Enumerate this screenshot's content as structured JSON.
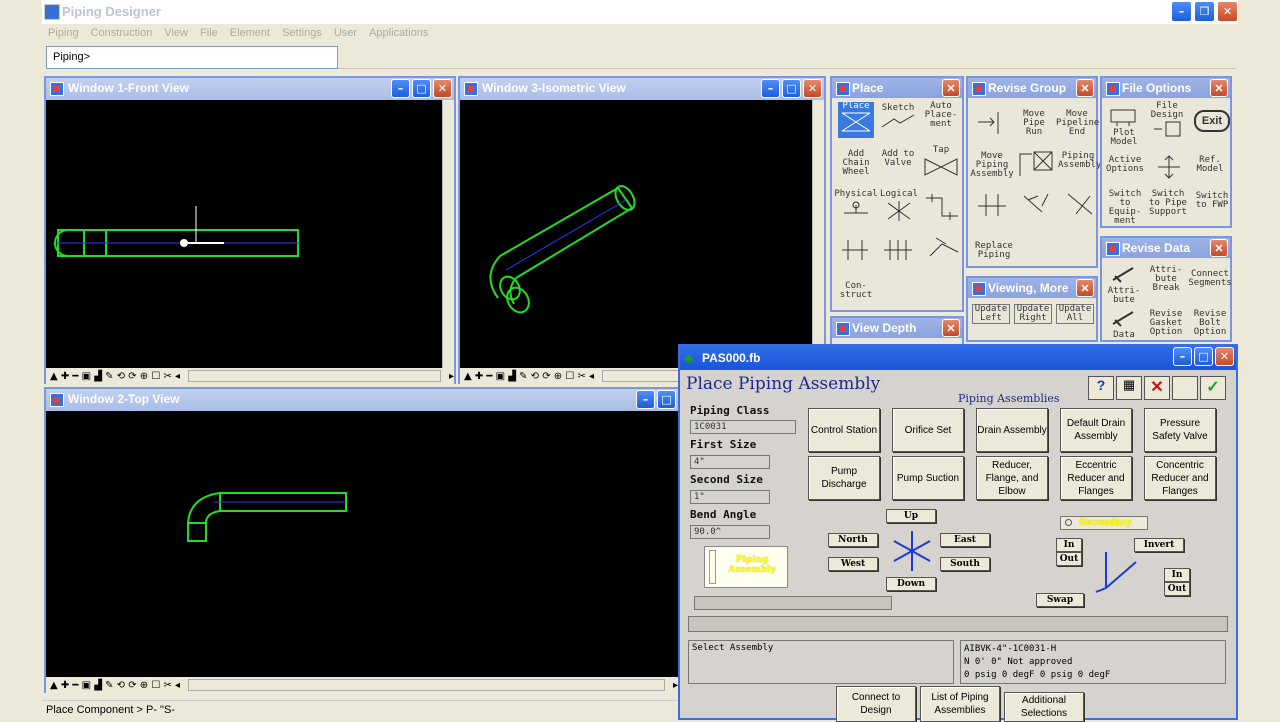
{
  "app": {
    "title": "Piping Designer",
    "menu": [
      "Piping",
      "Construction",
      "View",
      "File",
      "Element",
      "Settings",
      "User",
      "Applications"
    ],
    "command_prompt": "Piping>"
  },
  "views": {
    "front": {
      "title": "Window 1-Front View"
    },
    "iso": {
      "title": "Window 3-Isometric View"
    },
    "top": {
      "title": "Window 2-Top View"
    }
  },
  "palettes": {
    "place": {
      "title": "Place",
      "tools": [
        "Place",
        "Sketch",
        "Auto Place- ment",
        "Add Chain Wheel",
        "Add to Valve",
        "Tap",
        "Physical",
        "Logical",
        "Con- struct"
      ]
    },
    "revise_group": {
      "title": "Revise Group",
      "tools": [
        "Move Pipe Run",
        "Move Pipeline End",
        "Move Piping Assembly",
        "Piping Assembly",
        "Replace Piping"
      ]
    },
    "file_options": {
      "title": "File Options",
      "tools": [
        "Plot Model",
        "File Design",
        "Exit",
        "Active Options",
        "Ref. Model",
        "Switch to Equip- ment",
        "Switch to Pipe Support",
        "Switch to FWP"
      ]
    },
    "revise_data": {
      "title": "Revise Data",
      "tools": [
        "Attri- bute",
        "Attri- bute Break",
        "Connect Segments",
        "Data",
        "Revise Gasket Option",
        "Revise Bolt Option"
      ]
    },
    "viewing_more": {
      "title": "Viewing, More",
      "tools": [
        "Update Left",
        "Update Right",
        "Update All"
      ]
    },
    "view_depth": {
      "title": "View Depth"
    }
  },
  "dialog": {
    "window_title": "PAS000.fb",
    "heading": "Place Piping Assembly",
    "group_label": "Piping Assemblies",
    "fields": [
      {
        "label": "Piping Class",
        "value": "1C0031"
      },
      {
        "label": "First Size",
        "value": "4\""
      },
      {
        "label": "Second Size",
        "value": "1\""
      },
      {
        "label": "Bend Angle",
        "value": "90.0^"
      }
    ],
    "preview_label": "Piping Assembly",
    "assemblies": [
      "Control Station",
      "Orifice Set",
      "Drain Assembly",
      "Default Drain Assembly",
      "Pressure Safety Valve",
      "Pump Discharge",
      "Pump Suction",
      "Reducer, Flange, and Elbow",
      "Eccentric Reducer and Flanges",
      "Concentric Reducer and Flanges"
    ],
    "directions": {
      "up": "Up",
      "down": "Down",
      "north": "North",
      "south": "South",
      "east": "East",
      "west": "West"
    },
    "secondary_label": "Secondary",
    "controls": {
      "in1": "In",
      "out1": "Out",
      "invert": "Invert",
      "in2": "In",
      "out2": "Out",
      "swap": "Swap"
    },
    "message": "Select Assembly",
    "info": [
      "AIBVK-4\"-1C0031-H",
      "N  0' 0\"    Not approved",
      "0 psig  0 degF  0 psig  0 degF"
    ],
    "bottom_buttons": [
      "Connect to Design",
      "List of Piping Assemblies",
      "Additional Selections"
    ]
  },
  "status": {
    "text": "Place Component >   P-    \"S-"
  },
  "colors": {
    "pipe": "#22dd22",
    "centerline": "#3333ff",
    "title_active": "#1a55d6"
  }
}
